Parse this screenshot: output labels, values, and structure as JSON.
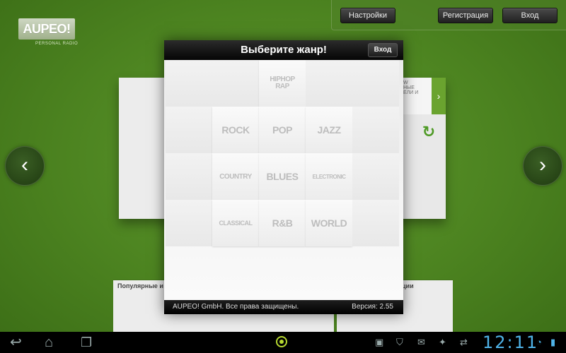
{
  "top_bar": {
    "settings_label": "Настройки",
    "register_label": "Регистрация",
    "login_label": "Вход"
  },
  "logo": {
    "text": "AUPEO!",
    "tagline": "PERSONAL RADIO"
  },
  "background": {
    "side_top_text": "W\nНЫЕ\nЕЛИ И",
    "popular_label": "Популярные и",
    "right_label": "ции"
  },
  "modal": {
    "title": "Выберите жанр!",
    "login_label": "Вход",
    "footer_copyright": "AUPEO! GmbH. Все права защищены.",
    "footer_version": "Версия: 2.55",
    "genres": [
      "HIPHOP RAP",
      "ROCK",
      "POP",
      "JAZZ",
      "COUNTRY",
      "BLUES",
      "ELECTRONIC",
      "CLASSICAL",
      "R&B",
      "WORLD"
    ]
  },
  "status_bar": {
    "clock": "12:11"
  },
  "icons": {
    "back": "back-icon",
    "home": "home-icon",
    "recent": "recent-apps-icon",
    "prev": "chevron-left-icon",
    "next": "chevron-right-icon"
  },
  "colors": {
    "accent_green": "#6aa32f",
    "clock_blue": "#4fb3e8"
  }
}
